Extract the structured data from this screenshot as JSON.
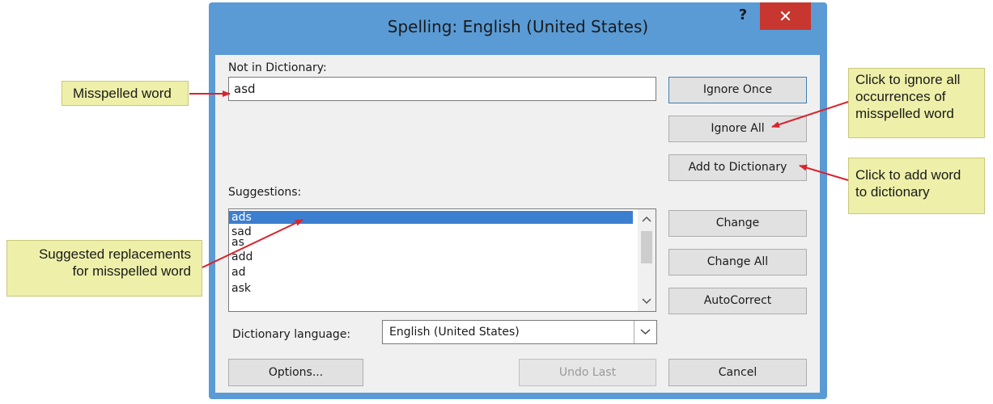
{
  "dialog": {
    "title": "Spelling: English (United States)",
    "help_label": "?",
    "close_label": "✕"
  },
  "not_in_dictionary": {
    "label": "Not in Dictionary:",
    "value": "asd"
  },
  "suggestions": {
    "label": "Suggestions:",
    "items": [
      "ads",
      "sad",
      "as",
      "add",
      "ad",
      "ask"
    ],
    "selected_index": 0
  },
  "dictionary_language": {
    "label": "Dictionary language:",
    "value": "English (United States)"
  },
  "buttons": {
    "ignore_once": "Ignore Once",
    "ignore_all": "Ignore All",
    "add_to_dictionary": "Add to Dictionary",
    "change": "Change",
    "change_all": "Change All",
    "autocorrect": "AutoCorrect",
    "options": "Options...",
    "undo_last": "Undo Last",
    "cancel": "Cancel"
  },
  "callouts": {
    "misspelled": "Misspelled word",
    "ignore_all": [
      "Click to ignore all",
      "occurrences of",
      "misspelled word"
    ],
    "add_word": [
      "Click to add word",
      "to dictionary"
    ],
    "suggested": [
      "Suggested replacements",
      "for misspelled word"
    ]
  },
  "colors": {
    "frame": "#5a9bd5",
    "close_button": "#c7372f",
    "selection": "#3c7fd0",
    "callout_fill": "#eef0a9",
    "arrow": "#d9232d"
  }
}
